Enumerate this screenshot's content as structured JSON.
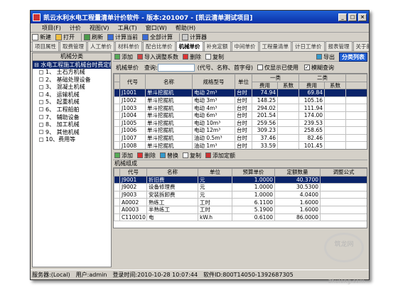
{
  "title": "凯云水利水电工程量清单计价软件 - 版本:201007 - [凯云清单测试项目]",
  "window_controls": [
    "_",
    "□",
    "×"
  ],
  "menu": [
    "项目(F)",
    "计价",
    "视图(V)",
    "工具(T)",
    "窗口(W)",
    "帮助(H)"
  ],
  "toolbar": [
    {
      "label": "新建",
      "icon": "new-icon"
    },
    {
      "label": "打开",
      "icon": "folder-icon"
    },
    {
      "label": "刷新",
      "icon": "refresh-icon"
    },
    {
      "label": "计算当前",
      "icon": "calc-icon"
    },
    {
      "label": "全部计算",
      "icon": "calc-all-icon"
    },
    {
      "label": "计算器",
      "icon": "calculator-icon"
    }
  ],
  "tabs": [
    "项目属性",
    "取费管理",
    "人工单价",
    "材料单价",
    "配合比单价",
    "机械单价",
    "补充定额",
    "中间单价",
    "工程量清单",
    "计日工单价",
    "报表管理",
    "关于郎云"
  ],
  "active_tab": "机械单价",
  "left_panel": {
    "header": "机械分类",
    "root": "水电工程施工机械台时费定额",
    "items": [
      "1、 土石方机械",
      "2、 基础处理设备",
      "3、 混凝土机械",
      "4、 运输机械",
      "5、 起重机械",
      "6、 工程船舶",
      "7、 辅助设备",
      "8、 加工机械",
      "9、 其他机械",
      "10、费用等"
    ]
  },
  "top_toolbar": {
    "add": "添加",
    "import": "导入调整系数",
    "delete": "删除",
    "copy": "复制",
    "export": "导出",
    "classify": "分类列表"
  },
  "search": {
    "label_machine": "机械单价",
    "query_label": "查询:",
    "hint": "(代号、名称、首字母)",
    "only_used": "仅显示已使用",
    "fuzzy": "模糊查询",
    "fuzzy_checked": true
  },
  "grid1": {
    "group_headers": [
      "一类",
      "二类"
    ],
    "headers": [
      "代号",
      "名称",
      "规格型号",
      "单位",
      "费用",
      "系数",
      "费用",
      "系数"
    ],
    "rows": [
      [
        "J1001",
        "单斗挖掘机",
        "电动 2m³",
        "台时",
        "74.94",
        "",
        "69.84",
        ""
      ],
      [
        "J1002",
        "单斗挖掘机",
        "电动 3m³",
        "台时",
        "148.25",
        "",
        "105.16",
        ""
      ],
      [
        "J1003",
        "单斗挖掘机",
        "电动 4m³",
        "台时",
        "294.02",
        "",
        "111.94",
        ""
      ],
      [
        "J1004",
        "单斗挖掘机",
        "电动 6m³",
        "台时",
        "201.54",
        "",
        "174.00",
        ""
      ],
      [
        "J1005",
        "单斗挖掘机",
        "电动 10m³",
        "台时",
        "259.56",
        "",
        "239.53",
        ""
      ],
      [
        "J1006",
        "单斗挖掘机",
        "电动 12m³",
        "台时",
        "309.23",
        "",
        "258.65",
        ""
      ],
      [
        "J1007",
        "单斗挖掘机",
        "油动 0.5m³",
        "台时",
        "37.46",
        "",
        "82.46",
        ""
      ],
      [
        "J1008",
        "单斗挖掘机",
        "油动 1m³",
        "台时",
        "33.59",
        "",
        "101.45",
        ""
      ],
      [
        "J1009",
        "单斗挖掘机",
        "油动 1.2m³",
        "台时",
        "37.86",
        "",
        "111.06",
        ""
      ],
      [
        "J1010",
        "单斗挖掘机",
        "油动 2m³",
        "台时",
        "64.31",
        "",
        "206.14",
        ""
      ]
    ],
    "selected_row": 0
  },
  "bottom_toolbar": {
    "add": "添加",
    "delete": "删除",
    "replace": "替换",
    "copy": "复制",
    "add_quota": "添加定额"
  },
  "grid2": {
    "section_title": "机械组成",
    "headers": [
      "代号",
      "名称",
      "单位",
      "预算单价",
      "定额数量",
      "调整公式"
    ],
    "rows": [
      [
        "J9001",
        "折旧费",
        "元",
        "1.0000",
        "40.3700",
        ""
      ],
      [
        "J9002",
        "设备修理费",
        "元",
        "1.0000",
        "30.5300",
        ""
      ],
      [
        "J9003",
        "安装拆卸费",
        "元",
        "1.0000",
        "4.0400",
        ""
      ],
      [
        "A0002",
        "熟练工",
        "工时",
        "6.1100",
        "1.6000",
        ""
      ],
      [
        "A0003",
        "半熟练工",
        "工时",
        "5.1900",
        "1.6000",
        ""
      ],
      [
        "C110010",
        "电",
        "kW.h",
        "0.6100",
        "86.0000",
        ""
      ]
    ],
    "selected_row": 0
  },
  "status": {
    "server": "服务器:(Local)",
    "user": "用户:admin",
    "login_time": "登录时间:2010-10-28 10:07:44",
    "sn": "软件ID:800T14050-1392687305"
  },
  "watermark": {
    "logo": "筑龙网",
    "url": "zhulong.com"
  }
}
